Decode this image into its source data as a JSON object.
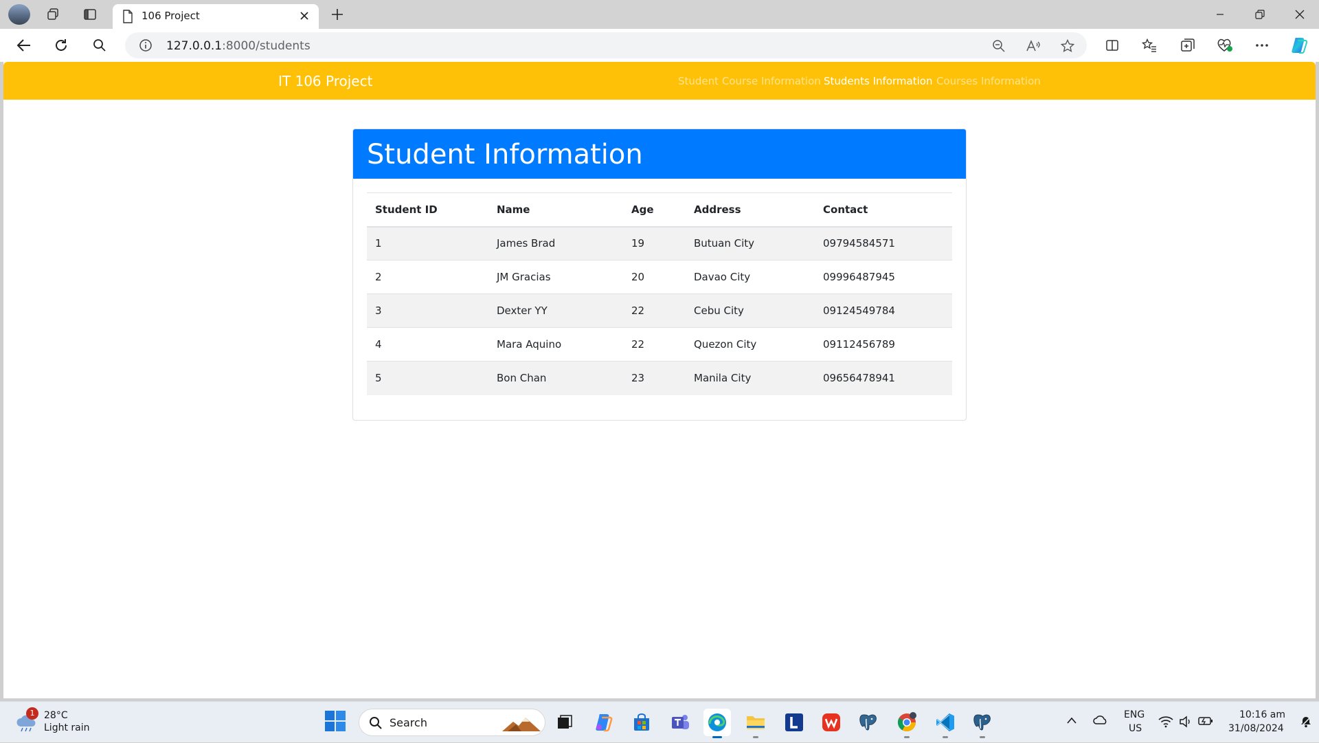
{
  "browser": {
    "tab_title": "106 Project",
    "url_host": "127.0.0.1",
    "url_path": ":8000/students"
  },
  "site": {
    "brand": "IT 106 Project",
    "nav": [
      {
        "label": "Student Course Information",
        "active": false
      },
      {
        "label": "Students Information",
        "active": true
      },
      {
        "label": "Courses Information",
        "active": false
      }
    ]
  },
  "card": {
    "title": "Student Information"
  },
  "table": {
    "headers": [
      "Student ID",
      "Name",
      "Age",
      "Address",
      "Contact"
    ],
    "rows": [
      [
        "1",
        "James Brad",
        "19",
        "Butuan City",
        "09794584571"
      ],
      [
        "2",
        "JM Gracias",
        "20",
        "Davao City",
        "09996487945"
      ],
      [
        "3",
        "Dexter YY",
        "22",
        "Cebu City",
        "09124549784"
      ],
      [
        "4",
        "Mara Aquino",
        "22",
        "Quezon City",
        "09112456789"
      ],
      [
        "5",
        "Bon Chan",
        "23",
        "Manila City",
        "09656478941"
      ]
    ]
  },
  "taskbar": {
    "weather_badge": "1",
    "weather_temp": "28°C",
    "weather_desc": "Light rain",
    "search_label": "Search",
    "lang_line1": "ENG",
    "lang_line2": "US",
    "time": "10:16 am",
    "date": "31/08/2024"
  },
  "colors": {
    "navbar": "#ffc107",
    "card_header": "#007bff",
    "stripe": "#f2f2f2"
  }
}
